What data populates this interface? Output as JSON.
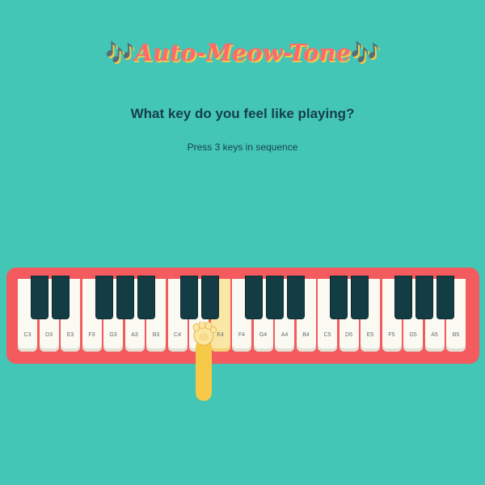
{
  "header": {
    "title": "Auto-Meow-Tone",
    "notes_glyph": "🎶"
  },
  "prompt": {
    "question": "What key do you feel like playing?",
    "instruction": "Press 3 keys in sequence"
  },
  "piano": {
    "white_keys": [
      "C3",
      "D3",
      "E3",
      "F3",
      "G3",
      "A3",
      "B3",
      "C4",
      "D4",
      "E4",
      "F4",
      "G4",
      "A4",
      "B4",
      "C5",
      "D5",
      "E5",
      "F5",
      "G5",
      "A5",
      "B5"
    ],
    "black_key_count": 15,
    "highlighted_key": "E4"
  },
  "colors": {
    "background": "#43c6b6",
    "frame": "#f35b5f",
    "title": "#ff6b6b",
    "title_shadow": "#f7c948",
    "text": "#163f48",
    "black_key": "#143c45",
    "highlight": "#fbe7a5",
    "paw": "#f7c948"
  },
  "icons": {
    "cursor": "cat-paw-icon"
  }
}
